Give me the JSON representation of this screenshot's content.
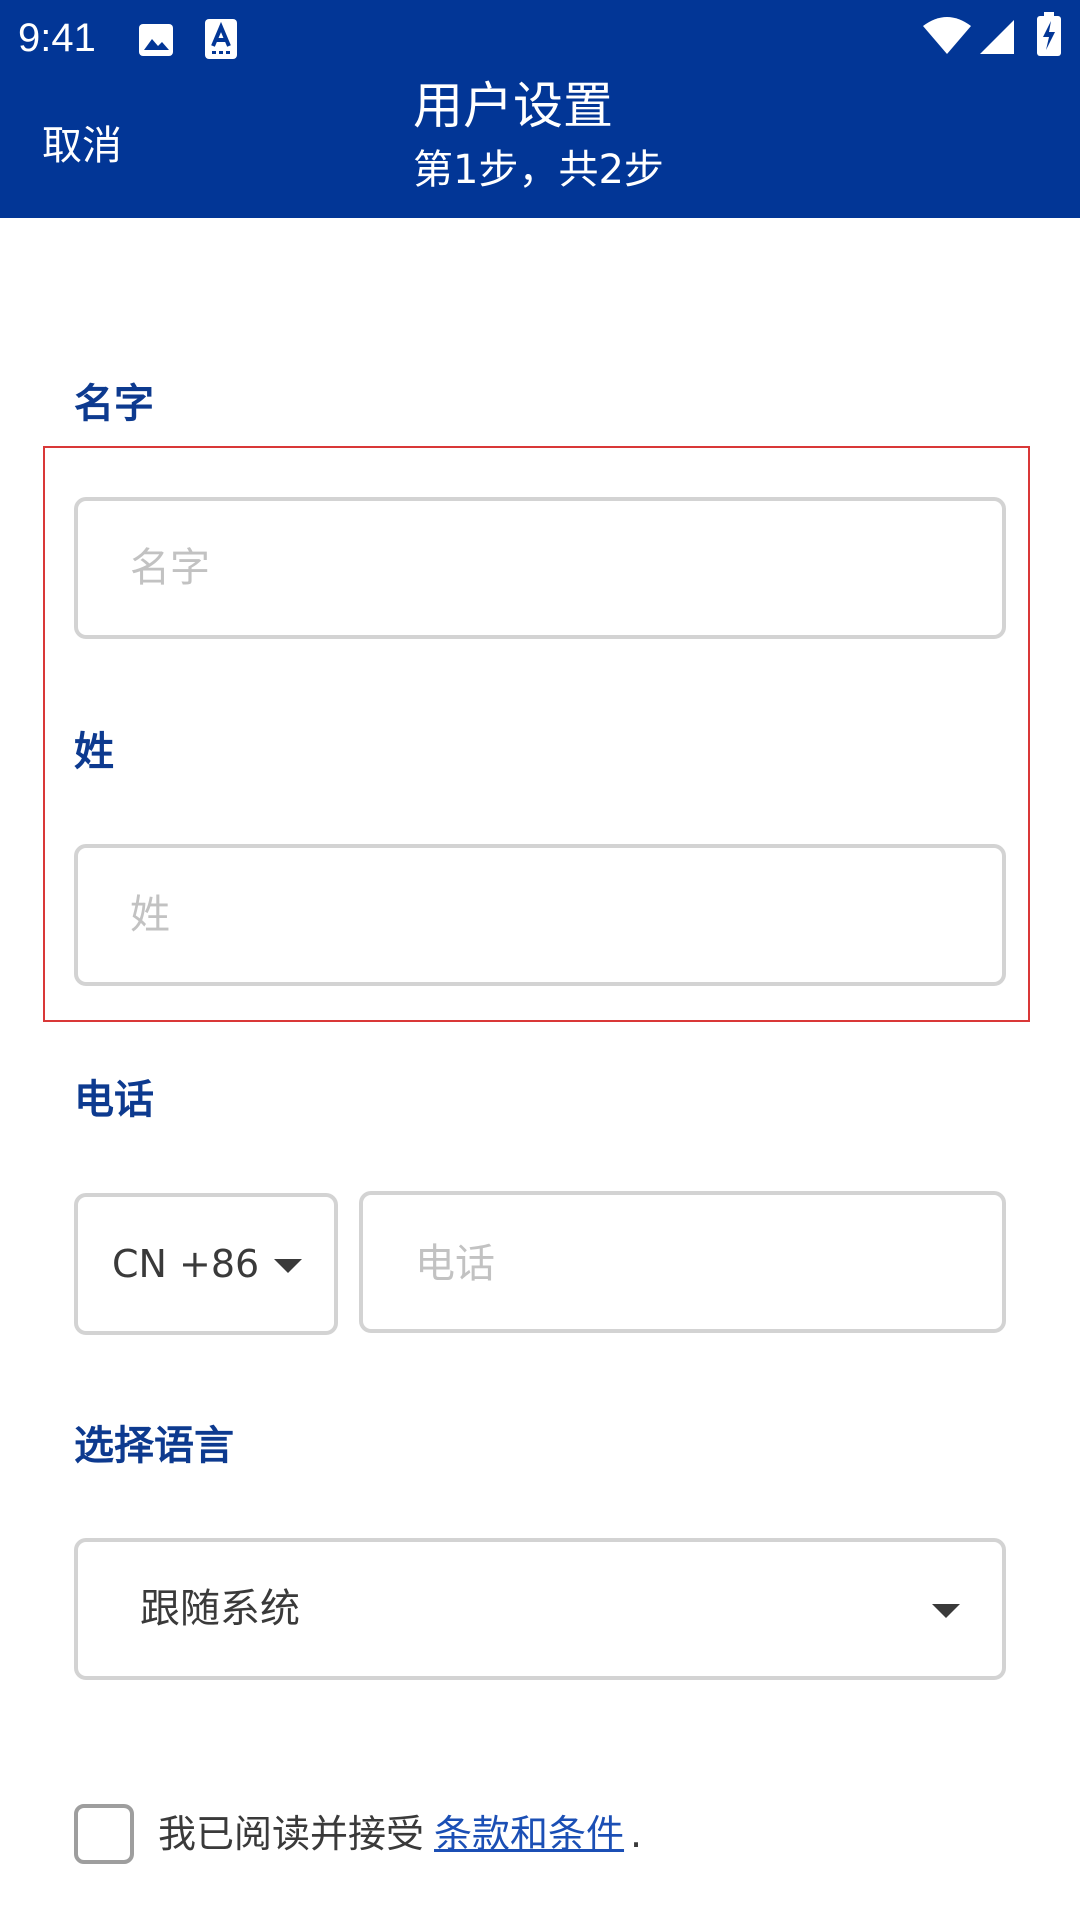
{
  "status_bar": {
    "time": "9:41",
    "icons": [
      "image-icon",
      "text-a-icon",
      "wifi-icon",
      "signal-icon",
      "battery-charging-icon"
    ]
  },
  "header": {
    "cancel_label": "取消",
    "title": "用户设置",
    "subtitle": "第1步，共2步"
  },
  "form": {
    "first_name": {
      "label": "名字",
      "placeholder": "名字",
      "value": ""
    },
    "last_name": {
      "label": "姓",
      "placeholder": "姓",
      "value": ""
    },
    "phone": {
      "label": "电话",
      "country_code": "CN +86",
      "placeholder": "电话",
      "value": ""
    },
    "language": {
      "label": "选择语言",
      "selected": "跟随系统"
    },
    "terms": {
      "checked": false,
      "text": "我已阅读并接受",
      "link": "条款和条件",
      "suffix": "."
    }
  },
  "colors": {
    "appbar": "#023696",
    "label": "#0d3a8f",
    "link": "#1b4fb5",
    "highlight": "#d93838"
  }
}
